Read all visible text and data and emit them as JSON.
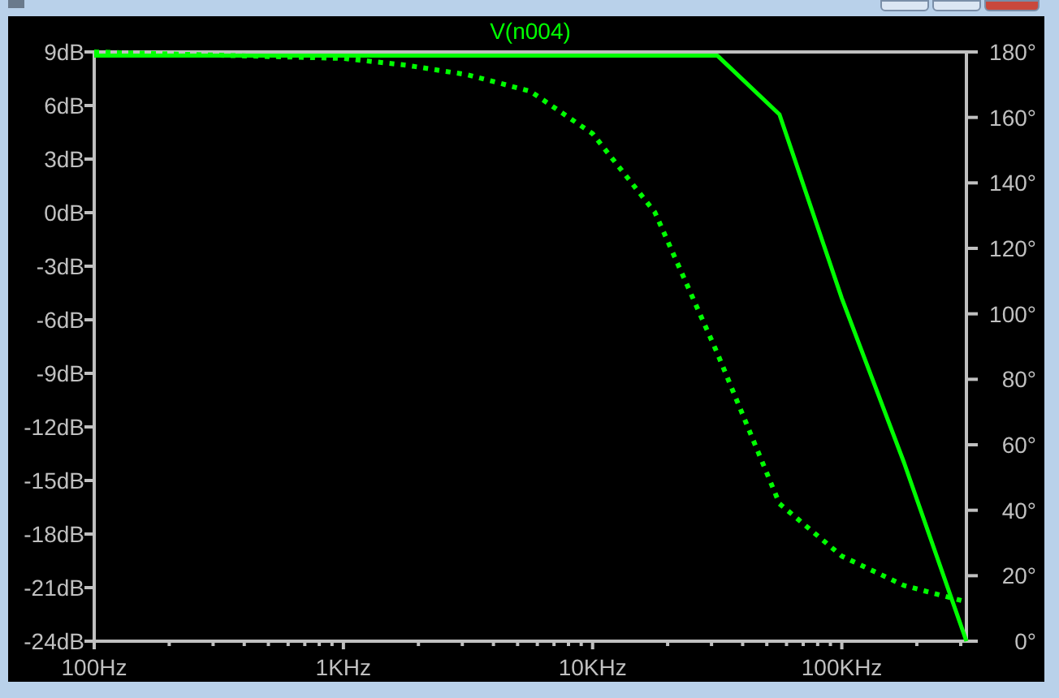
{
  "window": {
    "buttons": [
      {
        "kind": "minimize"
      },
      {
        "kind": "maximize"
      },
      {
        "kind": "close"
      }
    ]
  },
  "plot": {
    "chart_data": {
      "type": "line",
      "title": "V(n004)",
      "categories": [
        "100Hz",
        null,
        null,
        null,
        "1KHz",
        null,
        null,
        null,
        "10KHz",
        null,
        null,
        null,
        "100KHz",
        null,
        null
      ],
      "ylim": [
        -24,
        9
      ],
      "yticks": [
        {
          "value": 9,
          "label": "9dB"
        },
        {
          "value": 6,
          "label": "6dB"
        },
        {
          "value": 3,
          "label": "3dB"
        },
        {
          "value": 0,
          "label": "0dB"
        },
        {
          "value": -3,
          "label": "-3dB"
        },
        {
          "value": -6,
          "label": "-6dB"
        },
        {
          "value": -9,
          "label": "-9dB"
        },
        {
          "value": -12,
          "label": "-12dB"
        },
        {
          "value": -15,
          "label": "-15dB"
        },
        {
          "value": -18,
          "label": "-18dB"
        },
        {
          "value": -21,
          "label": "-21dB"
        },
        {
          "value": -24,
          "label": "-24dB"
        }
      ],
      "y2lim": [
        0,
        180
      ],
      "y2ticks": [
        {
          "value": 180,
          "label": "180°"
        },
        {
          "value": 160,
          "label": "160°"
        },
        {
          "value": 140,
          "label": "140°"
        },
        {
          "value": 120,
          "label": "120°"
        },
        {
          "value": 100,
          "label": "100°"
        },
        {
          "value": 80,
          "label": "80°"
        },
        {
          "value": 60,
          "label": "60°"
        },
        {
          "value": 40,
          "label": "40°"
        },
        {
          "value": 20,
          "label": "20°"
        },
        {
          "value": 0,
          "label": "0°"
        }
      ],
      "series": [
        {
          "color": "#00ff00",
          "values": [
            8.8,
            8.8,
            8.8,
            8.8,
            8.8,
            8.8,
            8.8,
            8.8,
            8.8,
            8.8,
            8.8,
            5.5,
            -4.8,
            -14.0,
            -24
          ]
        },
        {
          "color": "#00ff00",
          "axis": "y2",
          "line_style": "dotted",
          "values": [
            180,
            179.5,
            179,
            178.5,
            178,
            176,
            173,
            168,
            155,
            131,
            88,
            42,
            26,
            17,
            12
          ]
        }
      ]
    }
  }
}
